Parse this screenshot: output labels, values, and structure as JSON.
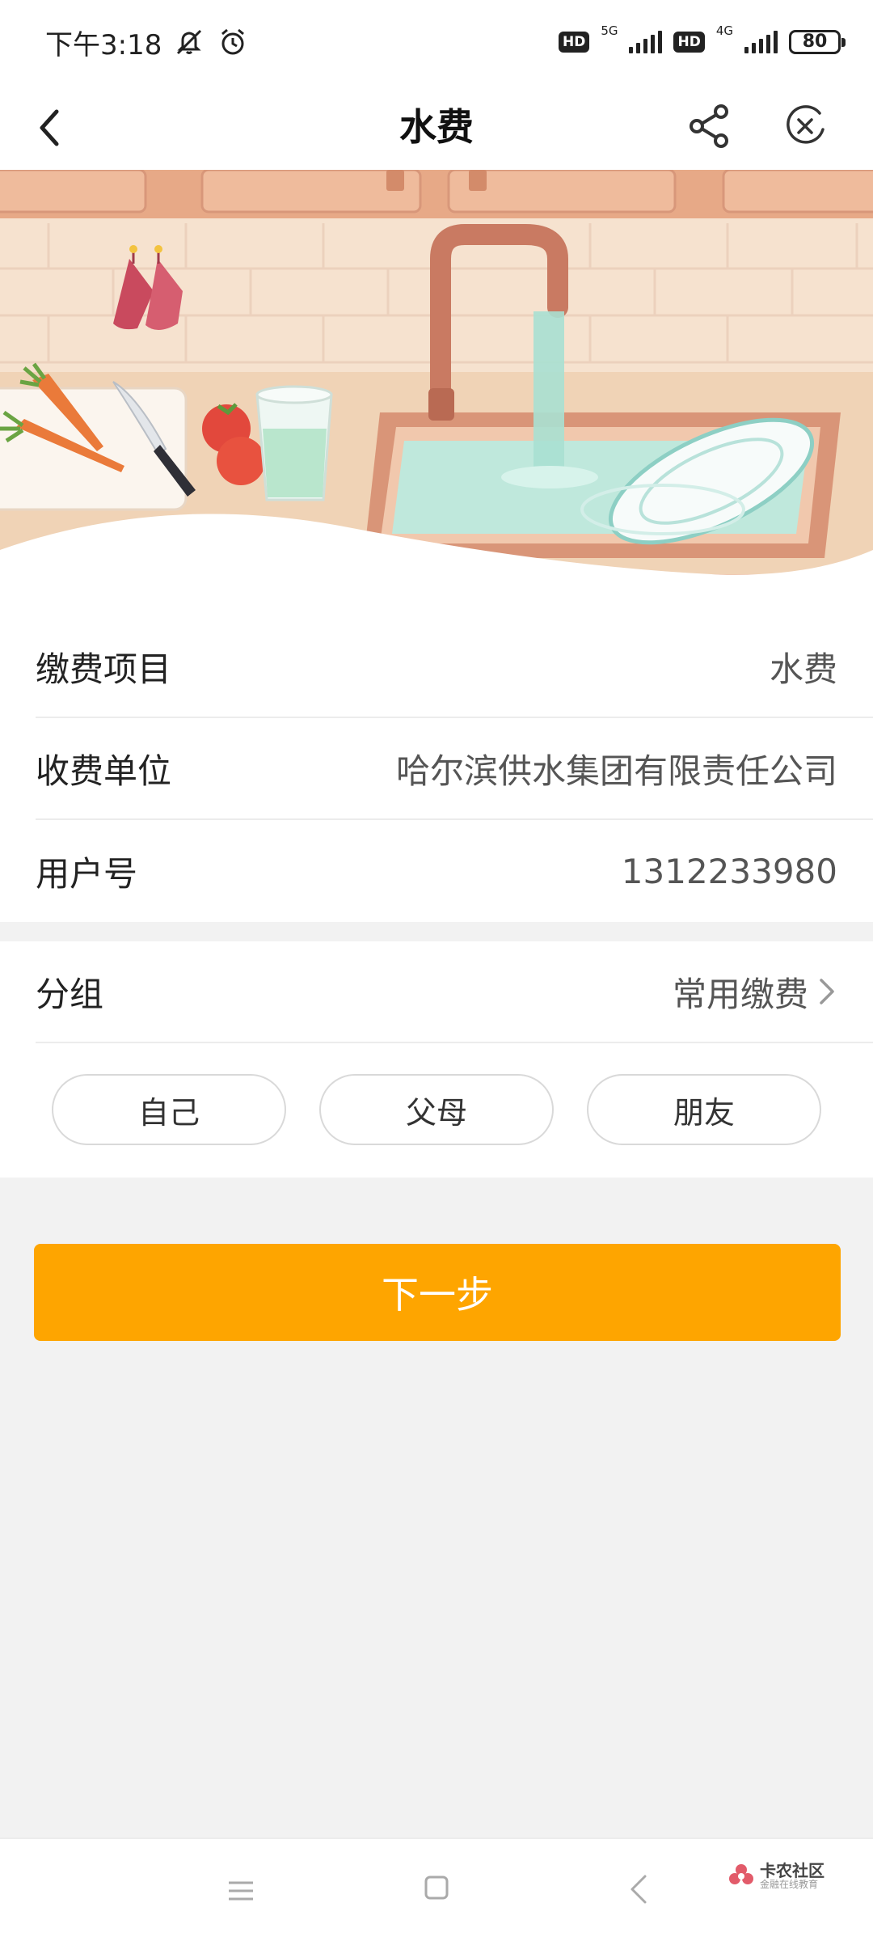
{
  "status_bar": {
    "time": "下午3:18",
    "hd1": "HD",
    "net1": "5G",
    "hd2": "HD",
    "net2": "4G",
    "battery": "80",
    "icons": [
      "mute-icon",
      "alarm-icon",
      "signal-icon",
      "battery-icon"
    ]
  },
  "nav": {
    "title": "水费",
    "icons": [
      "back-icon",
      "share-icon",
      "close-icon"
    ]
  },
  "fields": {
    "item_label": "缴费项目",
    "item_value": "水费",
    "unit_label": "收费单位",
    "unit_value": "哈尔滨供水集团有限责任公司",
    "account_label": "用户号",
    "account_value": "1312233980"
  },
  "group": {
    "label": "分组",
    "value": "常用缴费",
    "chips": [
      "自己",
      "父母",
      "朋友"
    ]
  },
  "actions": {
    "next_label": "下一步"
  },
  "watermark": {
    "main": "卡农社区",
    "sub": "金融在线教育"
  },
  "colors": {
    "accent": "#fea500",
    "background": "#f2f2f2"
  }
}
